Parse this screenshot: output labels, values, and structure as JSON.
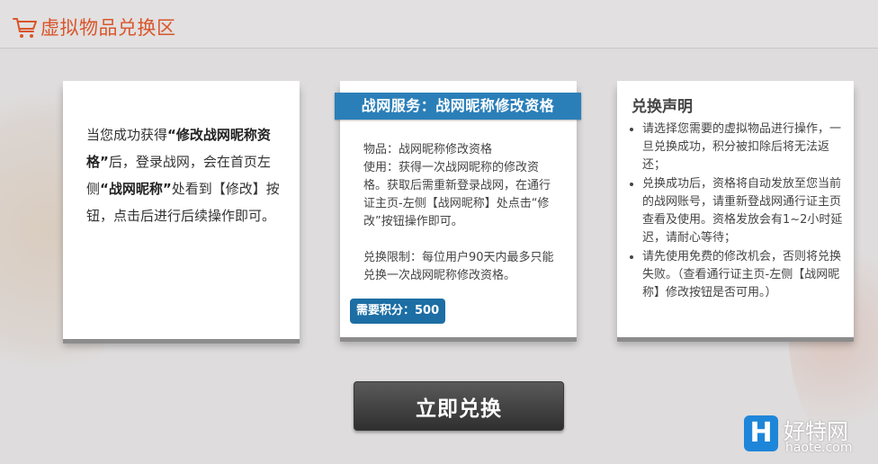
{
  "header": {
    "title": "虚拟物品兑换区",
    "icon": "cart-icon",
    "accent_color": "#d9552b"
  },
  "intro_card": {
    "text_1": "当您成功获得",
    "highlight_1": "“修改战网昵称资格”",
    "text_2": "后，登录战网，会在首页左侧",
    "highlight_2": "“战网昵称”",
    "text_3": "处看到【修改】按钮，点击后进行后续操作即可。"
  },
  "service_card": {
    "title": "战网服务：战网昵称修改资格",
    "banner_color": "#2b7fb8",
    "item_line": "物品：战网昵称修改资格",
    "usage_line": "使用：获得一次战网昵称的修改资格。获取后需重新登录战网，在通行证主页-左侧【战网昵称】处点击“修改”按钮操作即可。",
    "limit_line": "兑换限制：每位用户90天内最多只能兑换一次战网昵称修改资格。",
    "points_label": "需要积分：500",
    "points_color": "#1c6ea4"
  },
  "notice_card": {
    "title": "兑换声明",
    "items": [
      "请选择您需要的虚拟物品进行操作，一旦兑换成功，积分被扣除后将无法返还；",
      "兑换成功后，资格将自动发放至您当前的战网账号，请重新登战网通行证主页查看及使用。资格发放会有1~2小时延迟，请耐心等待；",
      "请先使用免费的修改机会，否则将兑换失败。（查看通行证主页-左侧【战网昵称】修改按钮是否可用。）"
    ]
  },
  "redeem_button": {
    "label": "立即兑换"
  },
  "watermark": {
    "logo_letter": "H",
    "name": "好特网",
    "url": "haote.com"
  }
}
